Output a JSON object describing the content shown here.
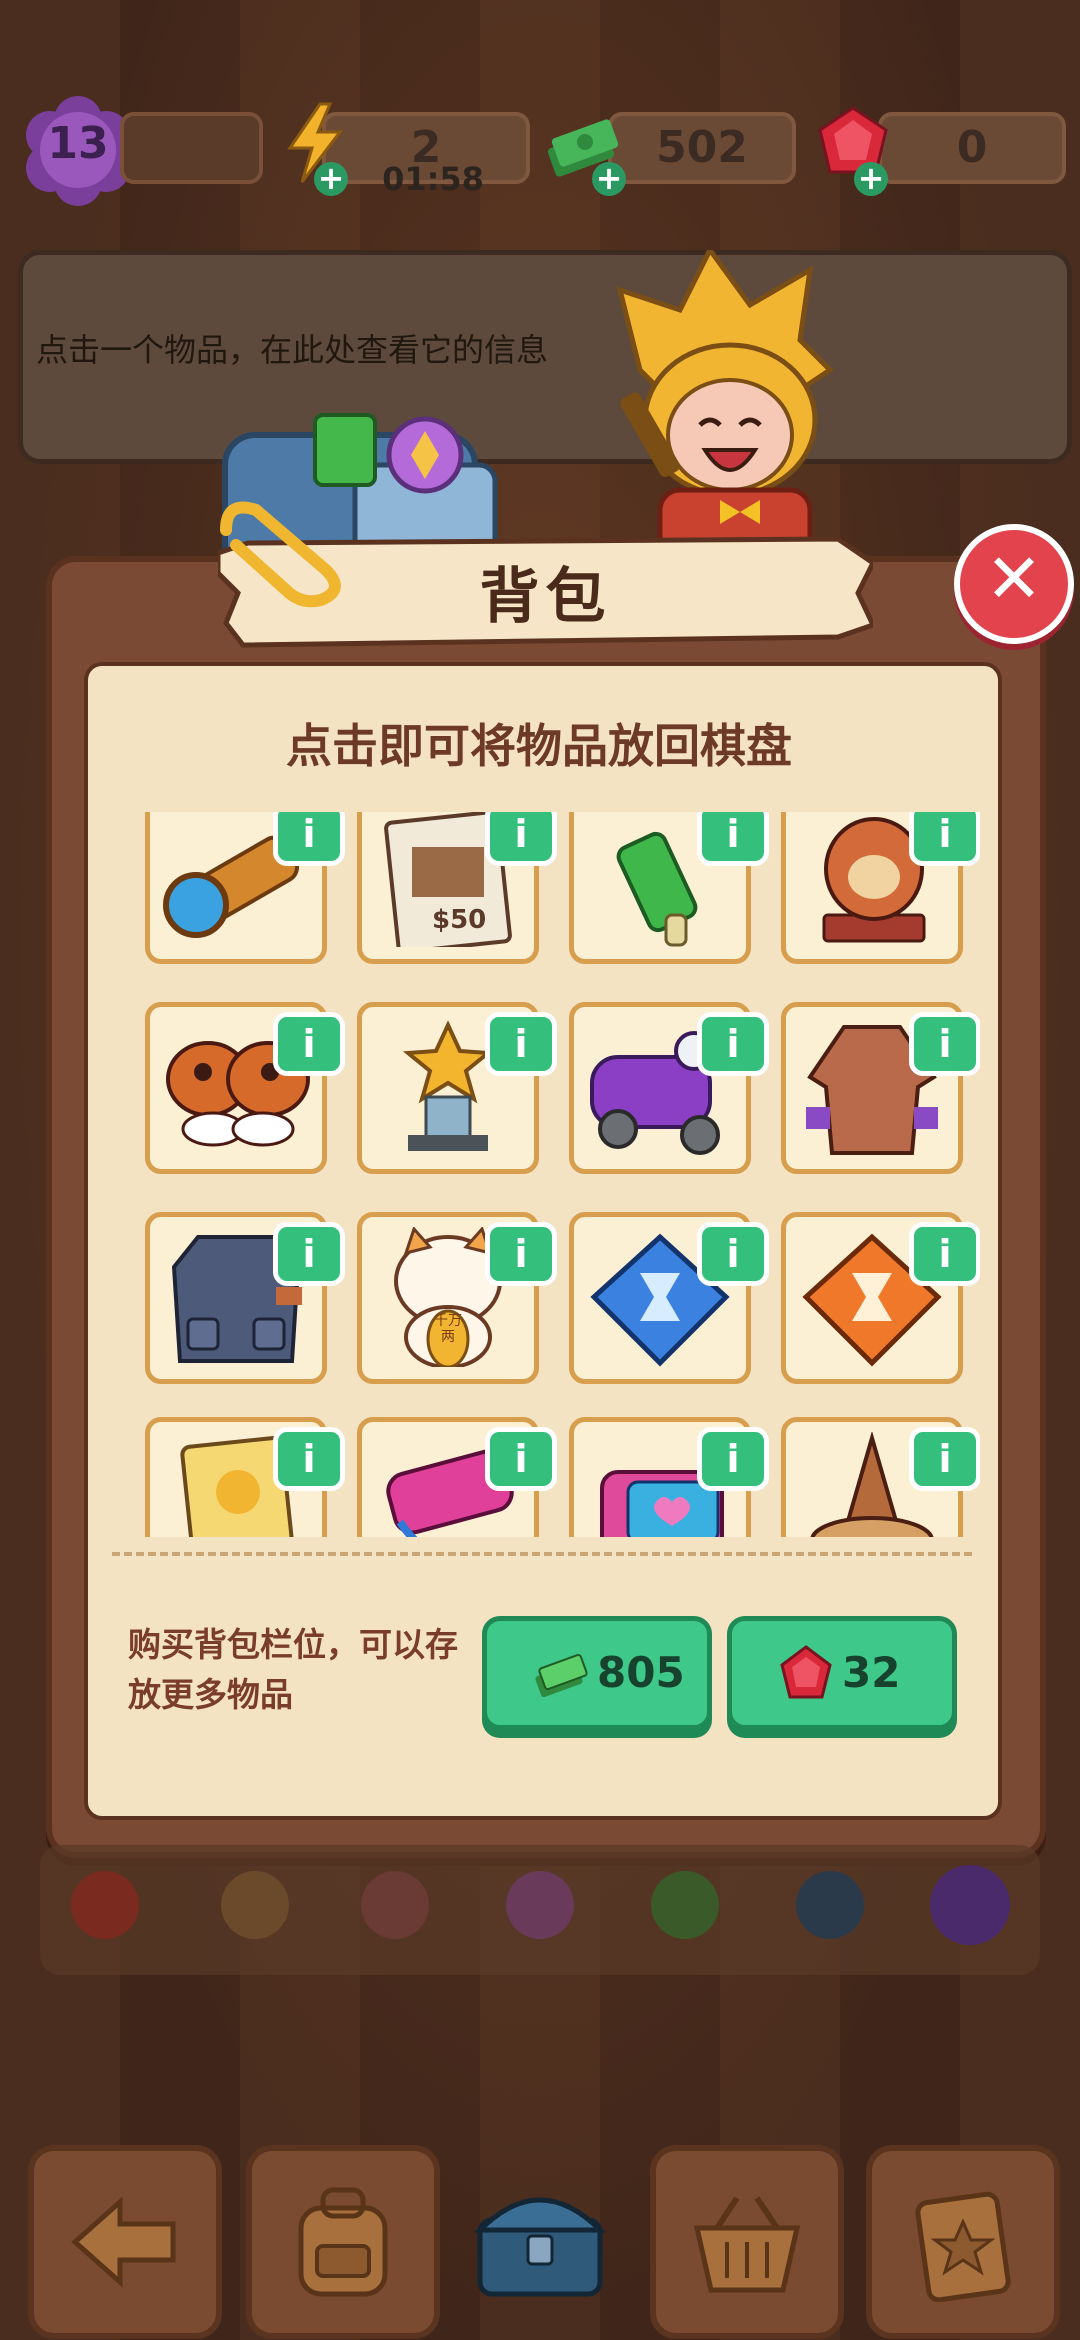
{
  "hud": {
    "level": "13",
    "energy": "2",
    "energy_timer": "01:58",
    "cash": "502",
    "gems": "0"
  },
  "info_panel": {
    "hint": "点击一个物品，在此处查看它的信息"
  },
  "modal": {
    "title": "背包",
    "subtitle": "点击即可将物品放回棋盘",
    "close_label": "✕",
    "items": [
      {
        "name": "telescope",
        "info": "i"
      },
      {
        "name": "wanted-poster",
        "info": "i",
        "poster_text": "$50"
      },
      {
        "name": "green-bottle-brush",
        "info": "i"
      },
      {
        "name": "wooden-statue",
        "info": "i"
      },
      {
        "name": "ladybug-moth",
        "info": "i"
      },
      {
        "name": "gold-trophy",
        "info": "i"
      },
      {
        "name": "purple-scooter",
        "info": "i"
      },
      {
        "name": "brown-coat",
        "info": "i"
      },
      {
        "name": "vest",
        "info": "i"
      },
      {
        "name": "lucky-cat",
        "info": "i",
        "coin_text": "千万两"
      },
      {
        "name": "blue-hourglass-gem",
        "info": "i"
      },
      {
        "name": "orange-hourglass-gem",
        "info": "i"
      },
      {
        "name": "photo-card",
        "info": "i"
      },
      {
        "name": "pink-pager",
        "info": "i"
      },
      {
        "name": "heart-lunchbox",
        "info": "i"
      },
      {
        "name": "cone-tower",
        "info": "i"
      }
    ],
    "buy_text": "购买背包栏位，可以存放更多物品",
    "buy_cash_price": "805",
    "buy_gem_price": "32"
  },
  "colors": {
    "modal_frame": "#7b4a35",
    "modal_paper": "#f4e3c3",
    "accent_green": "#3ec889",
    "close_red": "#e2434d",
    "slot_border": "#d79e4d"
  },
  "icons": {
    "level": "purple-flower-badge-icon",
    "energy": "lightning-icon",
    "cash": "cash-stack-icon",
    "gem": "red-gem-icon",
    "close": "close-icon",
    "back": "back-arrow-icon",
    "bag": "backpack-icon",
    "chest": "treasure-chest-icon",
    "basket": "basket-icon",
    "tasks": "clipboard-star-icon"
  }
}
